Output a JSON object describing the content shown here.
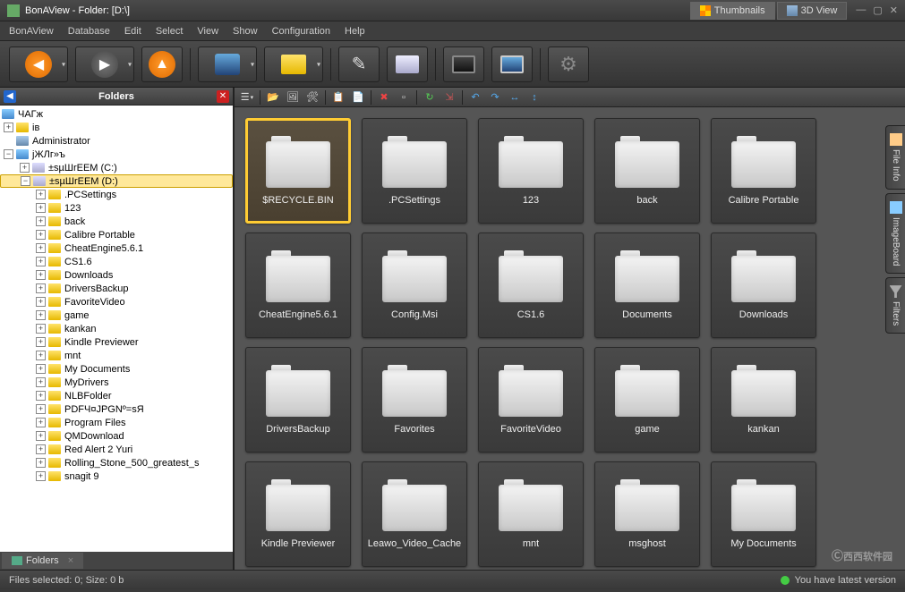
{
  "title": "BonAView - Folder: [D:\\]",
  "viewTabs": {
    "thumbnails": "Thumbnails",
    "threeD": "3D View"
  },
  "menus": [
    "BonAView",
    "Database",
    "Edit",
    "Select",
    "View",
    "Show",
    "Configuration",
    "Help"
  ],
  "foldersPanel": {
    "title": "Folders",
    "tabLabel": "Folders"
  },
  "tree": {
    "root": "ЧАГж",
    "l1_0": "ів",
    "l1_1": "Administrator",
    "l1_2": "јЖЛг»ъ",
    "drives": {
      "c": "±sµШrEEM (C:)",
      "d": "±sµШrEEM (D:)"
    },
    "dItems": [
      ".PCSettings",
      "123",
      "back",
      "Calibre Portable",
      "CheatEngine5.6.1",
      "CS1.6",
      "Downloads",
      "DriversBackup",
      "FavoriteVideo",
      "game",
      "kankan",
      "Kindle Previewer",
      "mnt",
      "My Documents",
      "MyDrivers",
      "NLBFolder",
      "PDFЧ¤JPGNº=sЯ",
      "Program Files",
      "QMDownload",
      "Red Alert 2 Yuri",
      "Rolling_Stone_500_greatest_s",
      "snagit 9"
    ]
  },
  "thumbs": [
    "$RECYCLE.BIN",
    ".PCSettings",
    "123",
    "back",
    "Calibre Portable",
    "CheatEngine5.6.1",
    "Config.Msi",
    "CS1.6",
    "Documents",
    "Downloads",
    "DriversBackup",
    "Favorites",
    "FavoriteVideo",
    "game",
    "kankan",
    "Kindle Previewer",
    "Leawo_Video_Cache",
    "mnt",
    "msghost",
    "My Documents"
  ],
  "sideTabs": {
    "fileInfo": "File Info",
    "imageBoard": "ImageBoard",
    "filters": "Filters"
  },
  "status": {
    "left": "Files selected: 0; Size: 0 b",
    "right": "You have latest version"
  },
  "watermark": "西西软件园"
}
